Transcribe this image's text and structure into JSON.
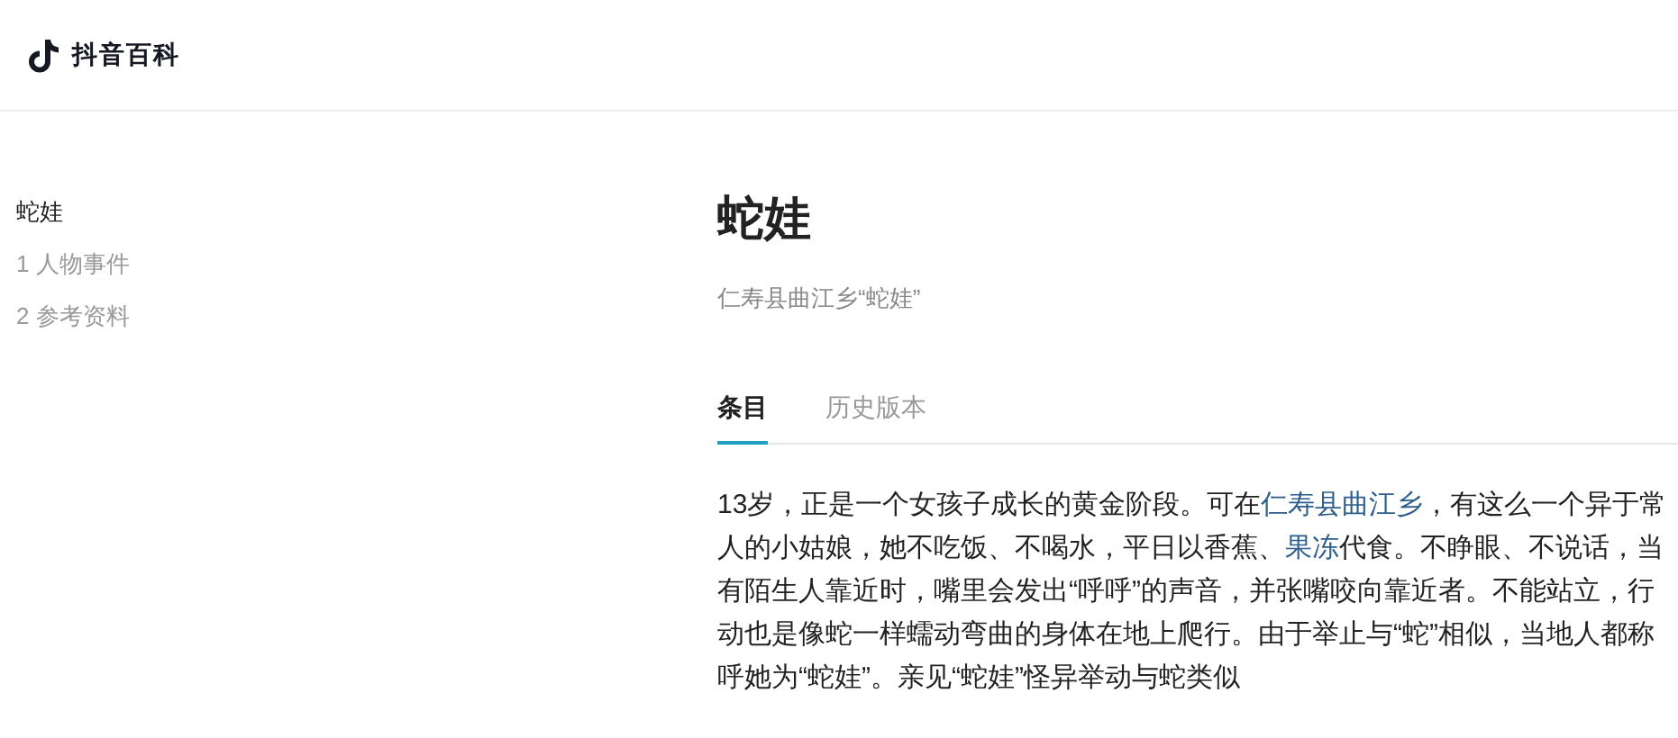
{
  "header": {
    "logo_text": "抖音百科"
  },
  "toc": [
    {
      "label": "蛇娃",
      "selected": true
    },
    {
      "label": "1 人物事件",
      "selected": false
    },
    {
      "label": "2 参考资料",
      "selected": false
    }
  ],
  "article": {
    "title": "蛇娃",
    "subtitle": "仁寿县曲江乡“蛇娃”",
    "tabs": [
      {
        "label": "条目",
        "selected": true
      },
      {
        "label": "历史版本",
        "selected": false
      }
    ],
    "paragraph": [
      {
        "text": "13岁，正是一个女孩子成长的黄金阶段。可在",
        "link": false
      },
      {
        "text": "仁寿县曲江乡",
        "link": true
      },
      {
        "text": "，有这么一个异于常人的小姑娘，她不吃饭、不喝水，平日以香蕉、",
        "link": false
      },
      {
        "text": "果冻",
        "link": true
      },
      {
        "text": "代食。不睁眼、不说话，当有陌生人靠近时，嘴里会发出“呼呼”的声音，并张嘴咬向靠近者。不能站立，行动也是像蛇一样蠕动弯曲的身体在地上爬行。由于举止与“蛇”相似，当地人都称呼她为“蛇娃”。亲见“蛇娃”怪异举动与蛇类似",
        "link": false
      }
    ]
  }
}
